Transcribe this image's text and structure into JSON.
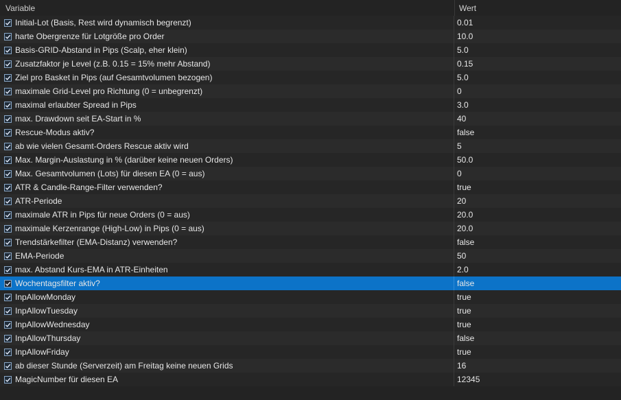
{
  "header": {
    "variable": "Variable",
    "value": "Wert"
  },
  "selected_row_index": 19,
  "colors": {
    "selection": "#0c73c8",
    "background": "#1e1e1e"
  },
  "rows": [
    {
      "label": "Initial-Lot (Basis, Rest wird dynamisch begrenzt)",
      "value": "0.01",
      "checked": true
    },
    {
      "label": "harte Obergrenze für Lotgröße pro Order",
      "value": "10.0",
      "checked": true
    },
    {
      "label": "Basis-GRID-Abstand in Pips (Scalp, eher klein)",
      "value": "5.0",
      "checked": true
    },
    {
      "label": "Zusatzfaktor je Level (z.B. 0.15 = 15% mehr Abstand)",
      "value": "0.15",
      "checked": true
    },
    {
      "label": "Ziel pro Basket in Pips (auf Gesamtvolumen bezogen)",
      "value": "5.0",
      "checked": true
    },
    {
      "label": "maximale Grid-Level pro Richtung (0 = unbegrenzt)",
      "value": "0",
      "checked": true
    },
    {
      "label": "maximal erlaubter Spread in Pips",
      "value": "3.0",
      "checked": true
    },
    {
      "label": "max. Drawdown seit EA-Start in %",
      "value": "40",
      "checked": true
    },
    {
      "label": "Rescue-Modus aktiv?",
      "value": "false",
      "checked": true
    },
    {
      "label": "ab wie vielen Gesamt-Orders Rescue aktiv wird",
      "value": "5",
      "checked": true
    },
    {
      "label": "Max. Margin-Auslastung in % (darüber keine neuen Orders)",
      "value": "50.0",
      "checked": true
    },
    {
      "label": "Max. Gesamtvolumen (Lots) für diesen EA (0 = aus)",
      "value": "0",
      "checked": true
    },
    {
      "label": "ATR & Candle-Range-Filter verwenden?",
      "value": "true",
      "checked": true
    },
    {
      "label": "ATR-Periode",
      "value": "20",
      "checked": true
    },
    {
      "label": "maximale ATR in Pips für neue Orders (0 = aus)",
      "value": "20.0",
      "checked": true
    },
    {
      "label": "maximale Kerzenrange (High-Low) in Pips (0 = aus)",
      "value": "20.0",
      "checked": true
    },
    {
      "label": "Trendstärkefilter (EMA-Distanz) verwenden?",
      "value": "false",
      "checked": true
    },
    {
      "label": "EMA-Periode",
      "value": "50",
      "checked": true
    },
    {
      "label": "max. Abstand Kurs-EMA in ATR-Einheiten",
      "value": "2.0",
      "checked": true
    },
    {
      "label": "Wochentagsfilter aktiv?",
      "value": "false",
      "checked": true
    },
    {
      "label": "InpAllowMonday",
      "value": "true",
      "checked": true
    },
    {
      "label": "InpAllowTuesday",
      "value": "true",
      "checked": true
    },
    {
      "label": "InpAllowWednesday",
      "value": "true",
      "checked": true
    },
    {
      "label": "InpAllowThursday",
      "value": "false",
      "checked": true
    },
    {
      "label": "InpAllowFriday",
      "value": "true",
      "checked": true
    },
    {
      "label": "ab dieser Stunde (Serverzeit) am Freitag keine neuen Grids",
      "value": "16",
      "checked": true
    },
    {
      "label": "MagicNumber für diesen EA",
      "value": "12345",
      "checked": true
    }
  ]
}
